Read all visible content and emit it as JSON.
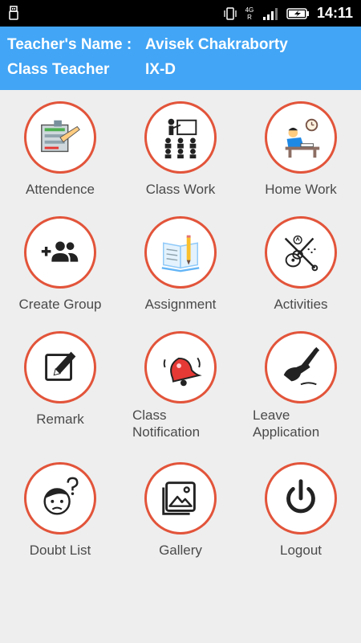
{
  "status_bar": {
    "network_label": "4G",
    "network_sub": "R",
    "time": "14:11"
  },
  "header": {
    "teacher_name_label": "Teacher's Name :",
    "teacher_name_value": "Avisek Chakraborty",
    "class_teacher_label": "Class Teacher",
    "class_teacher_value": "IX-D"
  },
  "menu": [
    {
      "label": "Attendence",
      "icon": "attendance-icon"
    },
    {
      "label": "Class Work",
      "icon": "class-work-icon"
    },
    {
      "label": "Home Work",
      "icon": "home-work-icon"
    },
    {
      "label": "Create Group",
      "icon": "create-group-icon"
    },
    {
      "label": "Assignment",
      "icon": "assignment-icon"
    },
    {
      "label": "Activities",
      "icon": "activities-icon"
    },
    {
      "label": "Remark",
      "icon": "remark-icon"
    },
    {
      "label": "Class\nNotification",
      "icon": "bell-icon"
    },
    {
      "label": "Leave\nApplication",
      "icon": "leave-application-icon"
    },
    {
      "label": "Doubt List",
      "icon": "doubt-icon"
    },
    {
      "label": "Gallery",
      "icon": "gallery-icon"
    },
    {
      "label": "Logout",
      "icon": "power-icon"
    }
  ],
  "colors": {
    "header_bg": "#42a5f5",
    "circle_border": "#e2543a",
    "background": "#eeeeee"
  }
}
